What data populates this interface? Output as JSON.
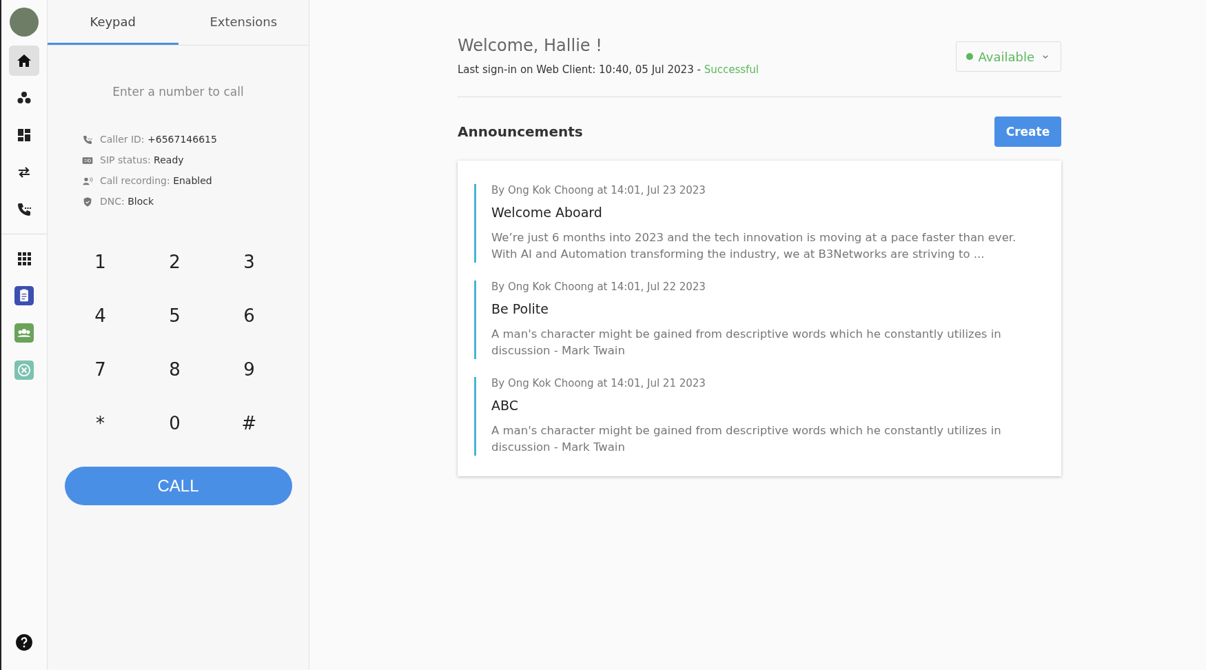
{
  "sidebar": {
    "top_items": [
      {
        "kind": "home",
        "selected": true
      },
      {
        "kind": "dots",
        "selected": false
      },
      {
        "kind": "dashboard",
        "selected": false
      },
      {
        "kind": "transfer",
        "selected": false
      },
      {
        "kind": "phone",
        "selected": false
      }
    ],
    "apps": [
      {
        "kind": "grid",
        "selected": false
      },
      {
        "kind": "clipboard",
        "selected": false
      },
      {
        "kind": "people",
        "selected": false
      },
      {
        "kind": "plane",
        "selected": false
      }
    ]
  },
  "tabs": [
    {
      "label": "Keypad",
      "selected": true
    },
    {
      "label": "Extensions",
      "selected": false
    }
  ],
  "dial": {
    "placeholder": "Enter a number to call"
  },
  "info": [
    {
      "kind": "phone",
      "label": "Caller ID:",
      "value": "+6567146615"
    },
    {
      "kind": "sip",
      "label": "SIP status:",
      "value": "Ready"
    },
    {
      "kind": "recording",
      "label": "Call recording:",
      "value": "Enabled"
    },
    {
      "kind": "shield",
      "label": "DNC:",
      "value": "Block"
    }
  ],
  "keys": [
    "1",
    "2",
    "3",
    "4",
    "5",
    "6",
    "7",
    "8",
    "9",
    "*",
    "0",
    "#"
  ],
  "call_button": "CALL",
  "header": {
    "welcome": "Welcome, Hallie !",
    "last_signin": "Last sign-in on Web Client: 10:40, 05 Jul 2023 -",
    "signin_result": "Successful",
    "status": {
      "label": "Available",
      "color": "#5cb85c"
    }
  },
  "announcements": {
    "title": "Announcements",
    "create_button": "Create",
    "items": [
      {
        "byline": "By Ong Kok Choong at 14:01, Jul 23 2023",
        "title": "Welcome Aboard",
        "body": "We’re just 6 months into 2023 and the tech innovation is moving at a pace faster than ever. With AI and Automation transforming the industry, we at B3Networks are striving to ..."
      },
      {
        "byline": "By Ong Kok Choong at 14:01, Jul 22 2023",
        "title": "Be Polite",
        "body": "A man's character might be gained from descriptive words which he constantly utilizes in discussion - Mark Twain"
      },
      {
        "byline": "By Ong Kok Choong at 14:01, Jul 21 2023",
        "title": "ABC",
        "body": "A man's character might be gained from descriptive words which he constantly utilizes in discussion - Mark Twain"
      }
    ]
  }
}
